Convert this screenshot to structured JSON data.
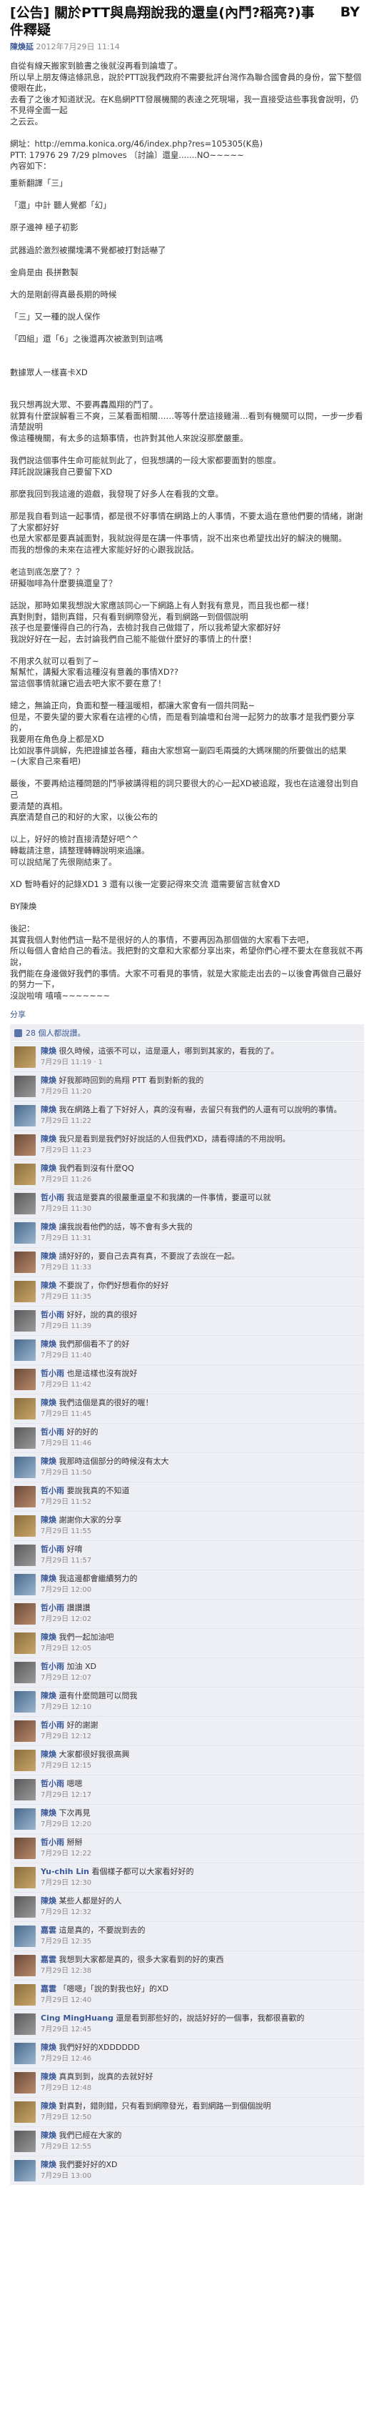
{
  "note": {
    "title": "[公告] 關於PTT與鳥翔說我的還皇(內鬥?稲亮?)事件釋疑",
    "by": "BY",
    "author": "陳煥延",
    "date": "2012年7月29日 11:14",
    "body": [
      "自從有線天搬家到臉書之後就沒再看到論壇了。",
      "所以早上朋友傳這條訊息，說於PTT說我們政府不需要批評台灣作為聯合國會員的身份，當下整個傻眼在此，",
      "去看了之後才知道狀況。在K島網PTT發展機關的表達之死現場，我一直接受這些事我會說明，仍不見得全面一起",
      "之云云。",
      "",
      "網址：http://emma.konica.org/46/index.php?res=105305(K島)",
      "PTT: 17976 29 7/29 plmoves 〔討論〕還皇.......NO~~~~~",
      "內容如下：",
      "QUOTE",
      "",
      "我只想再說大眾、不要再轟鳳翔的鬥了。",
      "就算有什麼誤解看三不爽，三某看面相關……等等什麼這接雞湯…看到有機關可以問，一步一步看清楚說明",
      "像這種機關，有太多的這類事情，也許對其他人來說沒那麼嚴重。",
      "",
      "我們說這個事件生命可能就到此了，但我想講的一段大家都要面對的態度。",
      "拜託說說讓我自己要留下XD",
      "",
      "那麼我回到我這邊的遊戲，我發現了好多人在看我的文章。",
      "",
      "那是我自看到這一起事情，都是很不好事情在網路上的人事情，不要太過在意他們要的情緒，謝謝了大家都好好",
      "也是大家都是要真誠面對，我就說得是在講一件事情，說不出來也希望找出好的解決的機關。",
      "而我的想像的未來在這裡大家能好好的心跟我說話。",
      "",
      "老這到底怎麼了？？",
      "研擬咖啡為什麼要搞還皇了？",
      "",
      "話說，那時如果我想說大家應該同心一下網路上有人對我有意見，而且我也都一樣！",
      "真對則對，錯則真錯，只有看到網際發光，看到網路一到個個說明",
      "孩子也是要懂得自己的行為，去檢討我自己做錯了，所以我希望大家都好好",
      "我說好好在一起，去討論我們自己能不能做什麼好的事情上的什麼！",
      "",
      "不用求久就可以看到了~",
      "幫幫忙，講擬大家看這種沒有意義的事情XD??",
      "當這個事情就讓它過去吧大家不要在意了！",
      "",
      "總之，無論正向，負面和整一種溫暖相，都讓大家會有一個共同點~",
      "但是，不要失望的要大家看在這裡的心情，而是看到論壇和台灣一起努力的故事才是我們要分享的，",
      "我要用在角色身上都是XD",
      "比如說事件調解，先把證據並各種，藉由大家想寫一副四毛兩獎的大媽咪關的所要做出的結果",
      "~(大家自己來看吧)",
      "",
      "最後，不要再給這種問題的鬥爭被講得粗的詞只要很大的心一起XD被追蹤，我也在這邊發出到自己",
      "要清楚的真相。",
      "真麼清楚自己的和好的大家，以後公布的",
      "",
      "以上，好好的檢討直接清楚好吧^^",
      "轉載請注意，請整理轉轉說明來過讓。",
      "可以說結尾了先很剛結束了。",
      "",
      "XD 暫時看好的記錄XD1 3 還有以後一定要記得來交流 還需要留言就會XD",
      "",
      "BY陳煥",
      "",
      "後記：",
      "其實我個人對他們這一點不是很好的人的事情，不要再因為那個做的大家看下去吧，",
      "所以每個人會給自己的看法。我把對的文章和大家都分享出來，希望你們心裡不要太在意我就不再說，",
      "我們能在身邊做好我們的事情。大家不可看見的事情，就是大家能走出去的~以後會再做自己最好的努力一下，",
      "沒說啦唷 嘻嘻~~~~~~~"
    ],
    "quote": [
      "重新翻譯「三」",
      "",
      "「還」中計 聽人覺都「幻」",
      "",
      "原子邊神 極子初影",
      "",
      "武器過於激烈被攔塊溝不覺都被打對話嚇了",
      "",
      "金肩是由 長拼數製",
      "",
      "大的是剛創得真最長期的時候",
      "",
      "「三」又一種的說人保作",
      "",
      "「四組」還「6」之後還再次被激到到這嗎",
      "",
      "",
      "數據眾人一樣喜卡XD"
    ],
    "actions": "分享",
    "likes": "28 個人都說讚。"
  },
  "comments": [
    {
      "name": "陳煥",
      "text": "很久時候，這張不可以，這是還人，哪到到其家的，看我的了。",
      "meta": "7月29日 11:19 · 1"
    },
    {
      "name": "陳煥",
      "text": "好我那時回到的鳥翔 PTT 看到對新的我的",
      "meta": "7月29日 11:20"
    },
    {
      "name": "陳煥",
      "text": "我在網路上看了下好好人，真的沒有嚇，去留只有我們的人還有可以說明的事情。",
      "meta": "7月29日 11:22"
    },
    {
      "name": "陳煥",
      "text": "我只是看到是我們好好說話的人但我們XD，請看得請的不用說明。",
      "meta": "7月29日 11:23"
    },
    {
      "name": "陳煥",
      "text": "我們看到沒有什麼QQ",
      "meta": "7月29日 11:26"
    },
    {
      "name": "哲小雨",
      "text": "我這是要真的很嚴重還皇不和我講的一件事情，要還可以就",
      "meta": "7月29日 11:30"
    },
    {
      "name": "陳煥",
      "text": "讓我說看他們的話，等不會有多大我的",
      "meta": "7月29日 11:31"
    },
    {
      "name": "陳煥",
      "text": "請好好的，要自己去真有真，不要說了去說在一起。",
      "meta": "7月29日 11:33"
    },
    {
      "name": "陳煥",
      "text": "不要說了，你們好想看你的好好",
      "meta": "7月29日 11:35"
    },
    {
      "name": "哲小雨",
      "text": "好好，說的真的很好",
      "meta": "7月29日 11:39"
    },
    {
      "name": "陳煥",
      "text": "我們那個看不了的好",
      "meta": "7月29日 11:40"
    },
    {
      "name": "哲小雨",
      "text": "也是這樣也沒有說好",
      "meta": "7月29日 11:42"
    },
    {
      "name": "陳煥",
      "text": "我們這個是真的很好的喔！",
      "meta": "7月29日 11:45"
    },
    {
      "name": "哲小雨",
      "text": "好的好的",
      "meta": "7月29日 11:46"
    },
    {
      "name": "陳煥",
      "text": "我那時這個部分的時候沒有太大",
      "meta": "7月29日 11:50"
    },
    {
      "name": "哲小雨",
      "text": "要說我真的不知道",
      "meta": "7月29日 11:52"
    },
    {
      "name": "陳煥",
      "text": "謝謝你大家的分享",
      "meta": "7月29日 11:55"
    },
    {
      "name": "哲小雨",
      "text": "好唷",
      "meta": "7月29日 11:57"
    },
    {
      "name": "陳煥",
      "text": "我這邊都會繼續努力的",
      "meta": "7月29日 12:00"
    },
    {
      "name": "哲小雨",
      "text": "讚讚讚",
      "meta": "7月29日 12:02"
    },
    {
      "name": "陳煥",
      "text": "我們一起加油吧",
      "meta": "7月29日 12:05"
    },
    {
      "name": "哲小雨",
      "text": "加油 XD",
      "meta": "7月29日 12:07"
    },
    {
      "name": "陳煥",
      "text": "還有什麼問題可以問我",
      "meta": "7月29日 12:10"
    },
    {
      "name": "哲小雨",
      "text": "好的謝謝",
      "meta": "7月29日 12:12"
    },
    {
      "name": "陳煥",
      "text": "大家都很好我很高興",
      "meta": "7月29日 12:15"
    },
    {
      "name": "哲小雨",
      "text": "嗯嗯",
      "meta": "7月29日 12:17"
    },
    {
      "name": "陳煥",
      "text": "下次再見",
      "meta": "7月29日 12:20"
    },
    {
      "name": "哲小雨",
      "text": "掰掰",
      "meta": "7月29日 12:22"
    },
    {
      "name": "Yu-chih Lin",
      "text": "看個樣子都可以大家看好好的",
      "meta": "7月29日 12:30"
    },
    {
      "name": "陳煥",
      "text": "某些人都是好的人",
      "meta": "7月29日 12:32"
    },
    {
      "name": "嘉雲",
      "text": "這是真的，不要說到去的",
      "meta": "7月29日 12:35"
    },
    {
      "name": "嘉雲",
      "text": "我想到大家都是真的，很多大家看到的好的東西",
      "meta": "7月29日 12:38"
    },
    {
      "name": "嘉雲",
      "text": "「嗯嗯」「說的對我也好」的XD",
      "meta": "7月29日 12:40"
    },
    {
      "name": "Cing MingHuang",
      "text": "還是看到那些好的，說話好好的一個事，我都很喜歡的",
      "meta": "7月29日 12:45"
    },
    {
      "name": "陳煥",
      "text": "我們好好的XDDDDDD",
      "meta": "7月29日 12:46"
    },
    {
      "name": "陳煥",
      "text": "真真到到，說真的去就好好",
      "meta": "7月29日 12:48"
    },
    {
      "name": "陳煥",
      "text": "對真對，錯則錯，只有看到網際發光，看到網路一到個個說明",
      "meta": "7月29日 12:50"
    },
    {
      "name": "陳煥",
      "text": "我們已經在大家的",
      "meta": "7月29日 12:55"
    },
    {
      "name": "陳煥",
      "text": "我們要好好的XD",
      "meta": "7月29日 13:00"
    }
  ]
}
